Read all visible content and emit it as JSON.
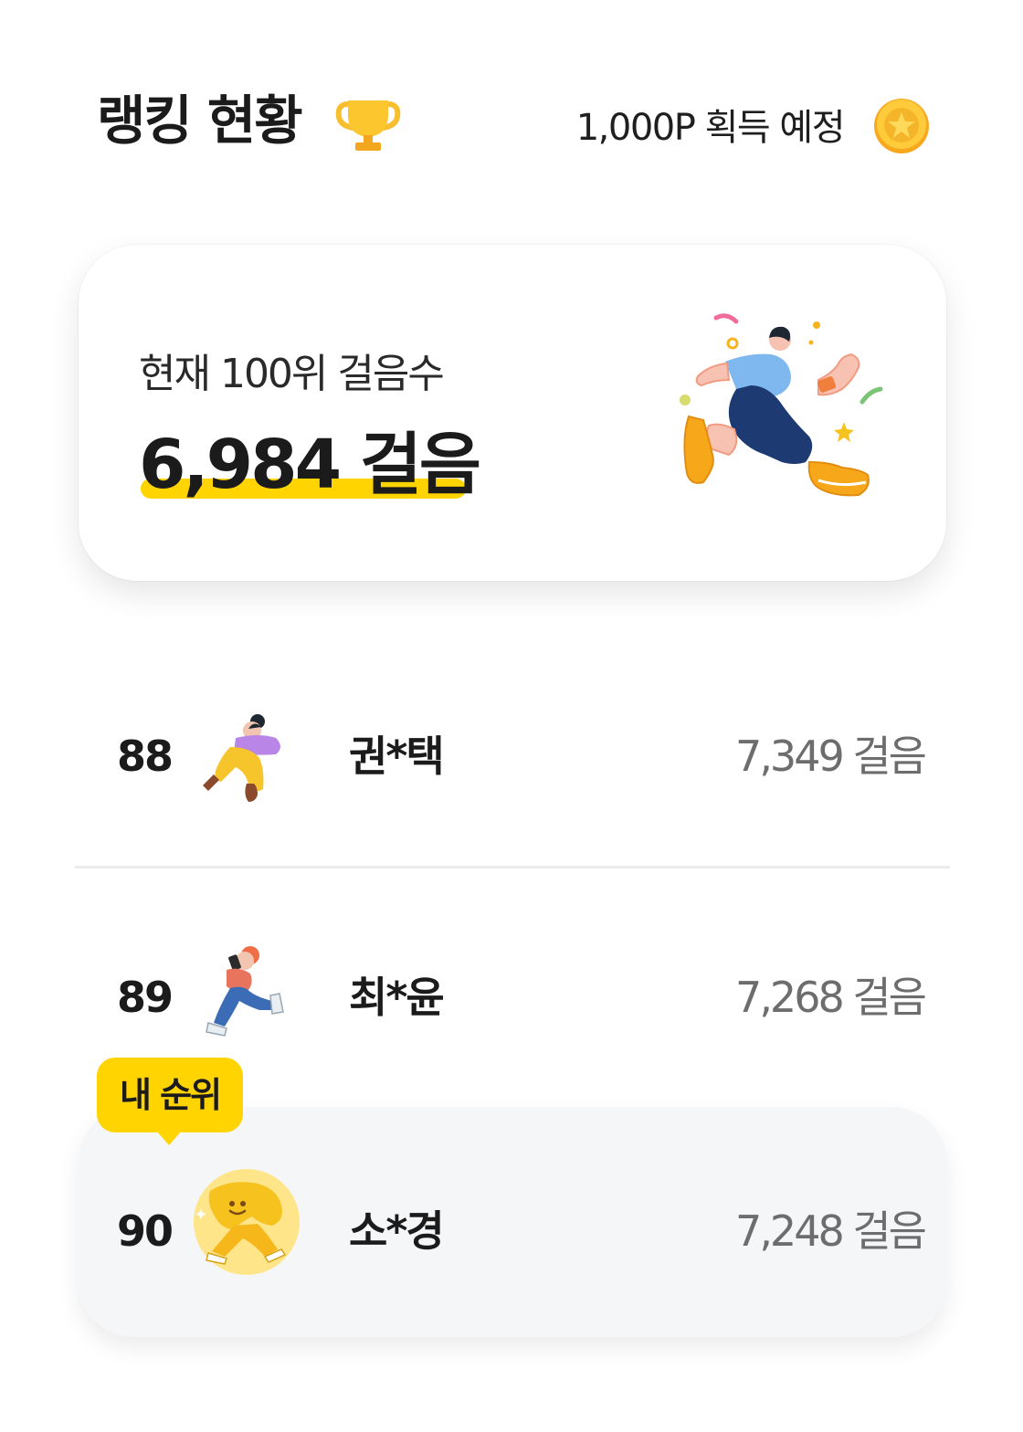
{
  "header": {
    "title": "랭킹 현황",
    "trophy_icon": "trophy-icon",
    "reward_text": "1,000P 획득 예정",
    "coin_icon": "star-coin-icon"
  },
  "summary": {
    "label": "현재 100위 걸음수",
    "value": "6,984 걸음",
    "illustration": "running-person-illustration",
    "highlight_color": "#ffd400"
  },
  "my_rank_badge": "내 순위",
  "rankings": [
    {
      "rank": "88",
      "name": "권*택",
      "steps": "7,349 걸음",
      "avatar": "person-lying-avatar"
    },
    {
      "rank": "89",
      "name": "최*윤",
      "steps": "7,268 걸음",
      "avatar": "person-phone-running-avatar"
    },
    {
      "rank": "90",
      "name": "소*경",
      "steps": "7,248 걸음",
      "avatar": "yellow-character-avatar"
    }
  ],
  "colors": {
    "accent": "#ffd400",
    "my_row_bg": "#f5f6f8",
    "steps_text": "#6d6d6d"
  }
}
